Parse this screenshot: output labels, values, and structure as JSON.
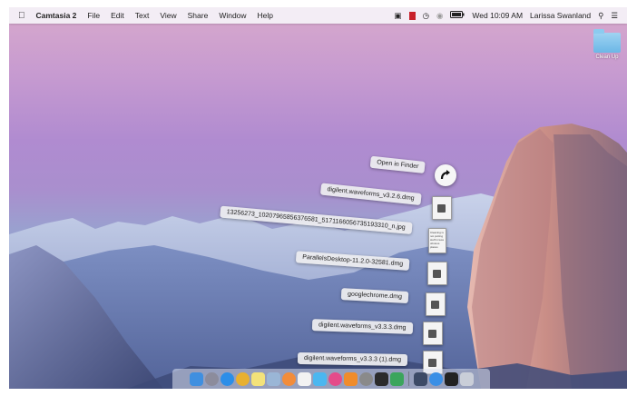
{
  "menubar": {
    "apple_icon": "apple-icon",
    "app_name": "Camtasia 2",
    "menus": [
      "File",
      "Edit",
      "Text",
      "View",
      "Share",
      "Window",
      "Help"
    ],
    "status_icons": [
      "camera-icon",
      "recording-icon",
      "time-machine-icon",
      "wifi-icon",
      "battery-icon"
    ],
    "battery_text": "⚡",
    "clock": "Wed 10:09 AM",
    "user": "Larissa Swanland",
    "search_icon": "spotlight-search-icon",
    "list_icon": "notification-center-icon"
  },
  "desktop": {
    "folder_label": "Clean Up"
  },
  "stack": {
    "open_in_finder": "Open in Finder",
    "items": [
      {
        "label": "digilent.waveforms_v3.2.6.dmg",
        "icon_text": ""
      },
      {
        "label": "13256273_10207965856376581_5171166056735193310_n.jpg",
        "icon_text": "Cleaning is not putting stuff in less obvious places"
      },
      {
        "label": "ParallelsDesktop-11.2.0-32581.dmg",
        "icon_text": ""
      },
      {
        "label": "googlechrome.dmg",
        "icon_text": ""
      },
      {
        "label": "digilent.waveforms_v3.3.3.dmg",
        "icon_text": ""
      },
      {
        "label": "digilent.waveforms_v3.3.3 (1).dmg",
        "icon_text": ""
      }
    ]
  },
  "dock": {
    "apps": [
      {
        "name": "finder",
        "color": "#3f8fe0"
      },
      {
        "name": "launchpad",
        "color": "#8c8c9c"
      },
      {
        "name": "safari",
        "color": "#2c8ee8"
      },
      {
        "name": "chrome",
        "color": "#e8b030"
      },
      {
        "name": "notes",
        "color": "#f3e27a"
      },
      {
        "name": "preview",
        "color": "#9ab6d6"
      },
      {
        "name": "photos",
        "color": "#f28c3a"
      },
      {
        "name": "calendar",
        "color": "#f2f2f2"
      },
      {
        "name": "messages",
        "color": "#4bb7f0"
      },
      {
        "name": "itunes",
        "color": "#e54b8a"
      },
      {
        "name": "ibooks",
        "color": "#f08c2c"
      },
      {
        "name": "system-preferences",
        "color": "#8a8a8a"
      },
      {
        "name": "camtasia",
        "color": "#2b2b2b"
      },
      {
        "name": "quicktime",
        "color": "#3ba55c"
      }
    ],
    "right_apps": [
      {
        "name": "downloads-stack",
        "color": "#3c4a66"
      },
      {
        "name": "app-store",
        "color": "#3a8fe6"
      },
      {
        "name": "terminal",
        "color": "#222222"
      },
      {
        "name": "trash",
        "color": "#c9ced8"
      }
    ]
  }
}
